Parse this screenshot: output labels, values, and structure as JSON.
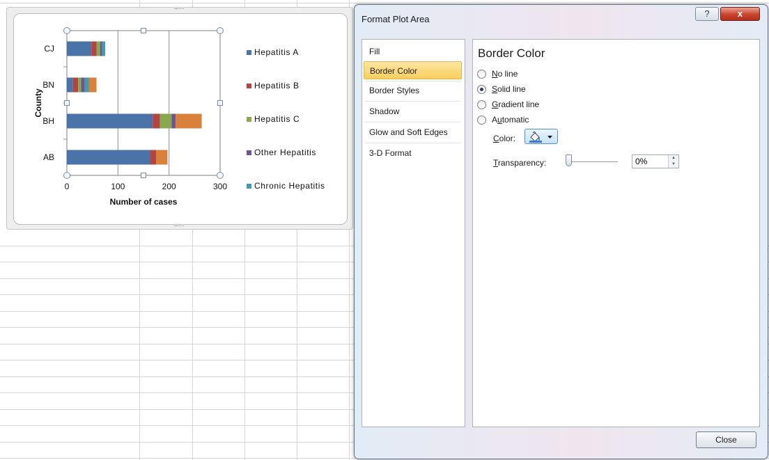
{
  "chart_data": {
    "type": "bar",
    "orientation": "horizontal",
    "stacked": true,
    "categories": [
      "CJ",
      "BN",
      "BH",
      "AB"
    ],
    "series": [
      {
        "name": "Hepatitis A",
        "color": "#4a74a8",
        "values": [
          48,
          12,
          168,
          163
        ]
      },
      {
        "name": "Hepatitis B",
        "color": "#b44343",
        "values": [
          10,
          10,
          14,
          12
        ]
      },
      {
        "name": "Hepatitis C",
        "color": "#89a84d",
        "values": [
          7,
          6,
          23,
          0
        ]
      },
      {
        "name": "Other Hepatitis",
        "color": "#6d568e",
        "values": [
          4,
          7,
          8,
          0
        ]
      },
      {
        "name": "Chronic Hepatitis",
        "color": "#3f9bb4",
        "values": [
          6,
          8,
          0,
          0
        ]
      },
      {
        "name": "",
        "color": "#d9813a",
        "values": [
          0,
          15,
          51,
          22
        ]
      }
    ],
    "xlabel": "Number of cases",
    "ylabel": "County",
    "xlim": [
      0,
      300
    ],
    "xticks": [
      "0",
      "100",
      "200",
      "300"
    ],
    "grid": true,
    "legend_position": "right"
  },
  "dialog": {
    "title": "Format Plot Area",
    "help_label": "?",
    "close_x_label": "x",
    "nav_items": [
      "Fill",
      "Border Color",
      "Border Styles",
      "Shadow",
      "Glow and Soft Edges",
      "3-D Format"
    ],
    "selected_nav": "Border Color",
    "section_title": "Border Color",
    "radio_options": [
      {
        "label": "No line",
        "key": "N",
        "rest": "o line",
        "checked": false
      },
      {
        "label": "Solid line",
        "key": "S",
        "rest": "olid line",
        "checked": true
      },
      {
        "label": "Gradient line",
        "key": "G",
        "rest": "radient line",
        "checked": false
      },
      {
        "label": "Automatic",
        "key": "A",
        "rest": "u",
        "rest2": "tomatic",
        "checked": false
      }
    ],
    "color_label_key": "C",
    "color_label_rest": "olor:",
    "transparency_key": "T",
    "transparency_rest": "ransparency:",
    "transparency_value": "0%",
    "close_button": "Close"
  },
  "icons": {
    "fill_color": "paint-bucket-icon",
    "dropdown": "dropdown-arrow-icon",
    "spin_up": "spin-up-icon",
    "spin_down": "spin-down-icon"
  }
}
